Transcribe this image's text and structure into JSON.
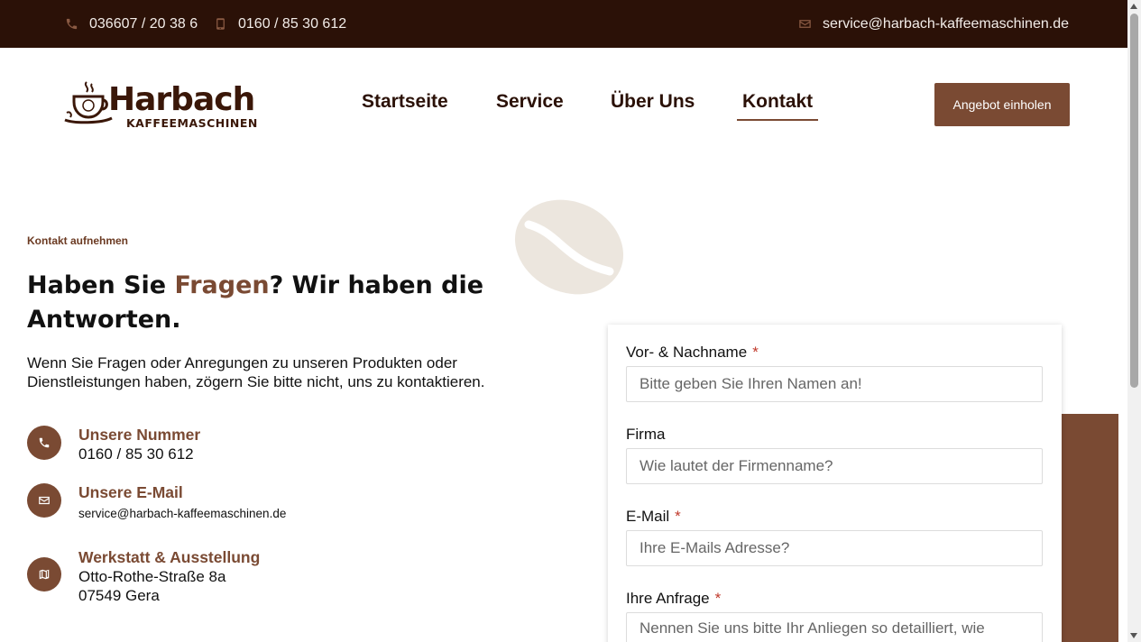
{
  "topbar": {
    "phone1": "036607 / 20 38 6",
    "phone2": "0160 / 85 30 612",
    "email": "service@harbach-kaffeemaschinen.de"
  },
  "logo": {
    "word": "Harbach",
    "sub": "KAFFEEMASCHINEN"
  },
  "nav": {
    "items": [
      {
        "label": "Startseite"
      },
      {
        "label": "Service"
      },
      {
        "label": "Über Uns"
      },
      {
        "label": "Kontakt"
      }
    ],
    "active": "Kontakt"
  },
  "cta": {
    "label": "Angebot einholen"
  },
  "hero": {
    "eyebrow": "Kontakt aufnehmen",
    "headline_pre": "Haben Sie ",
    "headline_accent": "Fragen",
    "headline_post": "? Wir haben die Antworten.",
    "intro": "Wenn Sie Fragen oder Anregungen zu unseren Produkten oder Dienstleistungen haben, zögern Sie bitte nicht, uns zu kontaktieren."
  },
  "contacts": {
    "phone": {
      "title": "Unsere Nummer",
      "value": "0160 / 85 30 612"
    },
    "email": {
      "title": "Unsere E-Mail",
      "value": "service@harbach-kaffeemaschinen.de"
    },
    "workshop": {
      "title": "Werkstatt & Ausstellung",
      "street": "Otto-Rothe-Straße 8a",
      "city": "07549 Gera"
    }
  },
  "form": {
    "name": {
      "label": "Vor- & Nachname",
      "required": "*",
      "placeholder": "Bitte geben Sie Ihren Namen an!"
    },
    "company": {
      "label": "Firma",
      "placeholder": "Wie lautet der Firmenname?"
    },
    "email": {
      "label": "E-Mail",
      "required": "*",
      "placeholder": "Ihre E-Mails Adresse?"
    },
    "request": {
      "label": "Ihre Anfrage",
      "required": "*",
      "placeholder": "Nennen Sie uns bitte Ihr Anliegen so detailliert, wie möglich!"
    }
  },
  "colors": {
    "brand_dark": "#2b1107",
    "brand_accent": "#7a4a33",
    "bean": "#ece6de"
  }
}
